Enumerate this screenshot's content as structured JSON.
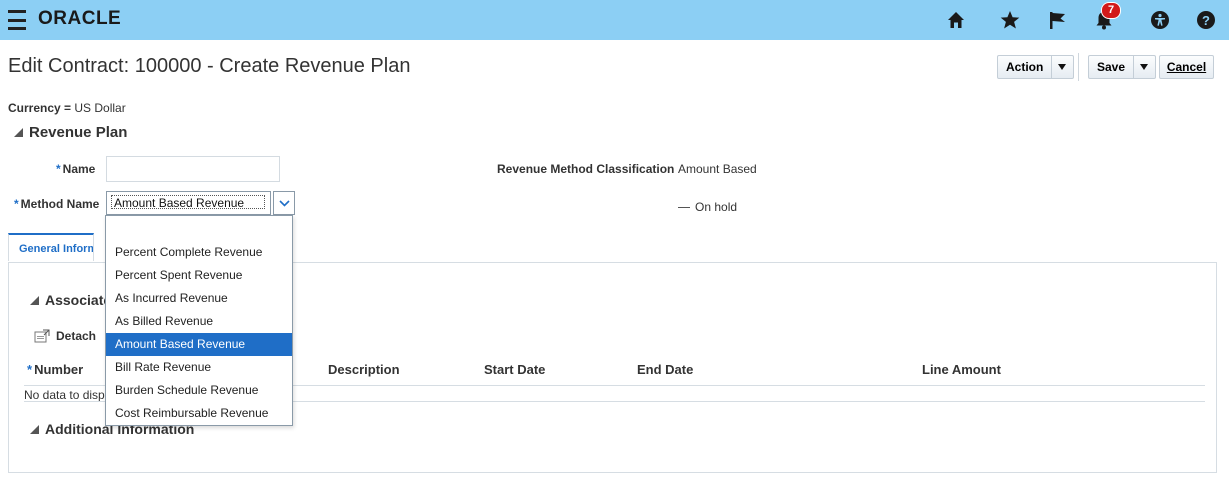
{
  "header": {
    "logo": "ORACLE",
    "notifications_count": "7",
    "icons": [
      "menu-icon",
      "home-icon",
      "star-icon",
      "flag-icon",
      "bell-icon",
      "accessibility-icon",
      "help-icon"
    ],
    "color": "#8ccff4"
  },
  "page": {
    "title": "Edit Contract: 100000 - Create Revenue Plan",
    "buttons": {
      "action": "Action",
      "save": "Save",
      "cancel": "Cancel"
    }
  },
  "form": {
    "currency_label": "Currency =",
    "currency_value": "US Dollar",
    "section_title": "Revenue Plan",
    "name_label": "Name",
    "name_value": "",
    "method_label": "Method Name",
    "method_value": "Amount Based Revenue",
    "rmc_label": "Revenue Method Classification",
    "rmc_value": "Amount Based",
    "on_hold_label": "On hold"
  },
  "tabs": {
    "general": "General Informa"
  },
  "associated": {
    "title": "Associate",
    "detach": "Detach",
    "columns": {
      "number": "Number",
      "description": "Description",
      "start_date": "Start Date",
      "end_date": "End Date",
      "line_amount": "Line Amount"
    },
    "no_data": "No data to displ"
  },
  "additional": {
    "title": "Additional Information"
  },
  "dropdown": {
    "options": [
      "Percent Complete Revenue",
      "Percent Spent Revenue",
      "As Incurred Revenue",
      "As Billed Revenue",
      "Amount Based Revenue",
      "Bill Rate Revenue",
      "Burden Schedule Revenue",
      "Cost Reimbursable Revenue"
    ],
    "selected": "Amount Based Revenue",
    "selected_color": "#1f6ec7"
  }
}
